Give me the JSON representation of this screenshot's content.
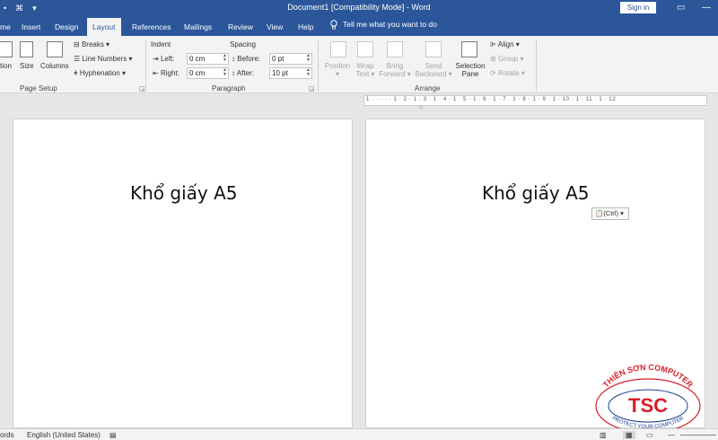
{
  "window": {
    "title": "Document1 [Compatibility Mode]  -  Word",
    "sign_in": "Sign in",
    "qat": [
      "•",
      "⌘",
      "▾"
    ],
    "controls": [
      "▭",
      "—"
    ]
  },
  "tabs": [
    {
      "label": "me"
    },
    {
      "label": "Insert"
    },
    {
      "label": "Design"
    },
    {
      "label": "Layout",
      "active": true
    },
    {
      "label": "References"
    },
    {
      "label": "Mailings"
    },
    {
      "label": "Review"
    },
    {
      "label": "View"
    },
    {
      "label": "Help"
    }
  ],
  "tell_me": {
    "icon": "lightbulb-icon",
    "text": "Tell me what you want to do"
  },
  "ribbon": {
    "page_setup": {
      "label": "Page Setup",
      "buttons": [
        "tion",
        "Size",
        "Columns"
      ],
      "breaks": "Breaks ▾",
      "line_numbers": "Line Numbers ▾",
      "hyphenation": "Hyphenation ▾"
    },
    "paragraph": {
      "label": "Paragraph",
      "indent_header": "Indent",
      "spacing_header": "Spacing",
      "left_label": "Left:",
      "left_value": "0 cm",
      "right_label": "Right:",
      "right_value": "0 cm",
      "before_label": "Before:",
      "before_value": "0 pt",
      "after_label": "After:",
      "after_value": "10 pt"
    },
    "arrange": {
      "label": "Arrange",
      "position": [
        "Position",
        "▾"
      ],
      "wrap_text": [
        "Wrap",
        "Text ▾"
      ],
      "bring_forward": [
        "Bring",
        "Forward ▾"
      ],
      "send_backward": [
        "Send",
        "Backward ▾"
      ],
      "selection_pane": [
        "Selection",
        "Pane"
      ],
      "align": "Align ▾",
      "group": "Group ▾",
      "rotate": "Rotate ▾"
    }
  },
  "ruler": {
    "ticks": "1 · · · · · 1 · 2 · 1 · 3 · 1 · 4 · 1 · 5 · 1 · 6 · 1 · 7 · 1 · 8 · 1 · 9 · 1 · 10 · 1 · 11 · 1 · 12"
  },
  "pages": [
    {
      "text": "Khổ giấy A5"
    },
    {
      "text": "Khổ giấy A5"
    }
  ],
  "paste_options": "(Ctrl) ▾",
  "status": {
    "words": "ords",
    "language": "English (United States)"
  },
  "logo": {
    "top_arc": "THIÊN SƠN COMPUTER",
    "letters": "TSC",
    "bottom_arc": "PROTECT YOUR COMPUTER",
    "color": "#d81e2c",
    "accent": "#1a3f8f"
  }
}
